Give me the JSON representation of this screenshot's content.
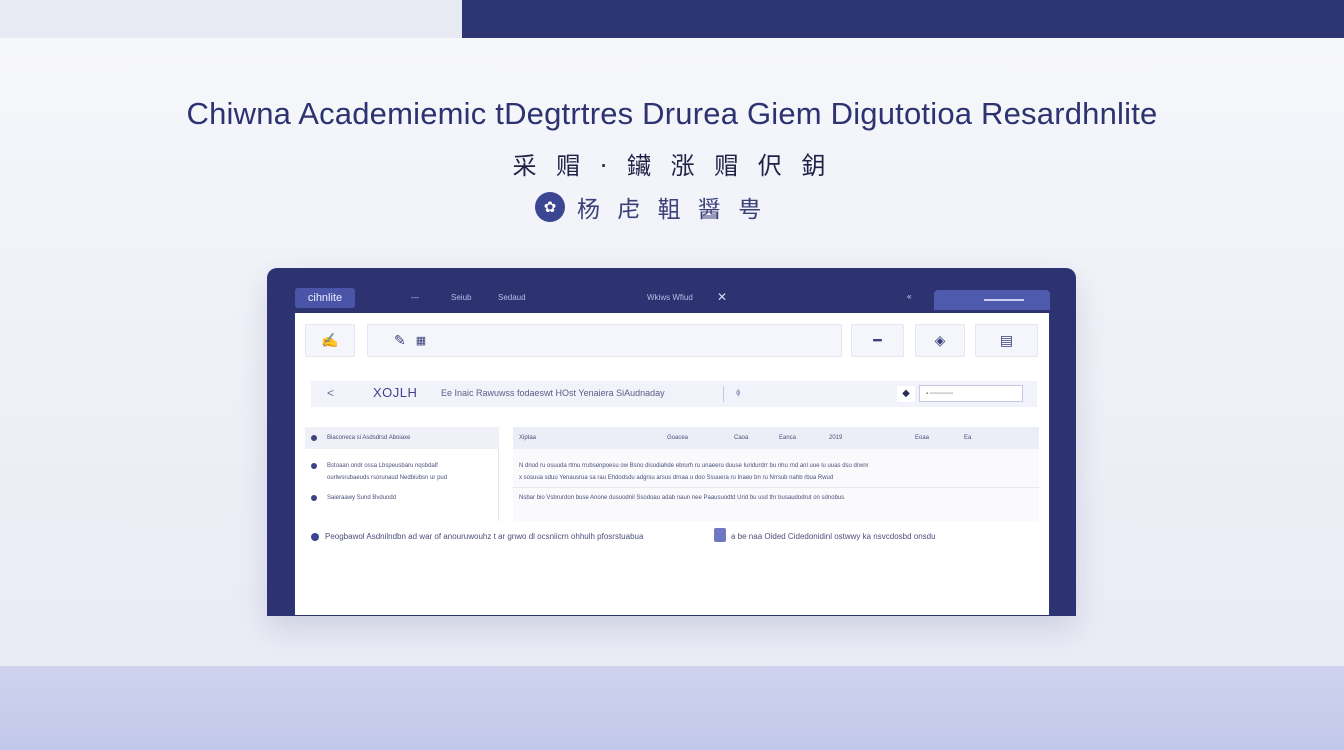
{
  "hero": {
    "headline": "Chiwna Academiemic tDegtrtres Drurea Giem Digutotioa Resardhnlite",
    "subline": "采 赗 · 鑶 涨 赗 伬 鈅",
    "brand_text": "杨 虍 靻 醤 甹",
    "brand_icon": "graduation-cap-icon"
  },
  "app": {
    "tab_label": "cihnlite",
    "nav_links": [
      "—",
      "Seiub",
      "Sedaud"
    ],
    "nav_center": "Wkiws Wfiud",
    "nav_right": "«",
    "toolbar_icons": [
      "scholar-icon",
      "document-icon",
      "ink-drop-icon",
      "report-icon"
    ],
    "crumb": {
      "back": "<",
      "title": "XOJLH",
      "description": "Ee Inaic Rawuwss fodaeswt HOst Yenaiera SiAudnaday",
      "mark": "ɸ",
      "icon": "◆",
      "search_placeholder": "▪ ▫▫▫▫▫▫▫▫▫▫▫"
    },
    "table": {
      "left_header": "Biaconeca si Asdsdrsd  Aboiaxe",
      "left_rows": [
        "Bstoaan ondr ossa Lbspeusbaru nqsbdalf",
        "ourlwsrubaeuds rsorunaud Nedbiubsn ur pud",
        "Saieraawy Sund Bvduodd"
      ],
      "right_headers": [
        "Xiptaa",
        "Goacea",
        "Caoa",
        "Eanca",
        "2019",
        "Eoaa",
        "Ea"
      ],
      "right_rows": [
        "N dnod ru osuuda rtmu rrubsenpoesu ow Bsno disodiahde ebrurh ru unaeeru duuse Iuridurdrr bu nhu rnd anl uue lu uuas dsu drwnr",
        "x sosuua sduu Yenausrua sa rau Ehdodsdu adgrsu arsus drnaa u doo Ssuuera ru Inaeu bn ru Nrrsub nahb rbua Rwud",
        "Nsbar bio Vsbrurdon buse Anone dusuodnil Ssodoau adab naun nee Paausuodtd Urid bu usd thr busaudodrut on sdnobus"
      ]
    },
    "footer_note": "Peogbawol Asdnilndbn ad war of anouruwouhz t ar gnwo dl ocsniicrn ohhulh pfosrstuabua",
    "footer_note_2": "a be naa Oided  Cidedonidinl ostwwy ka nsvcdosbd onsdu"
  }
}
